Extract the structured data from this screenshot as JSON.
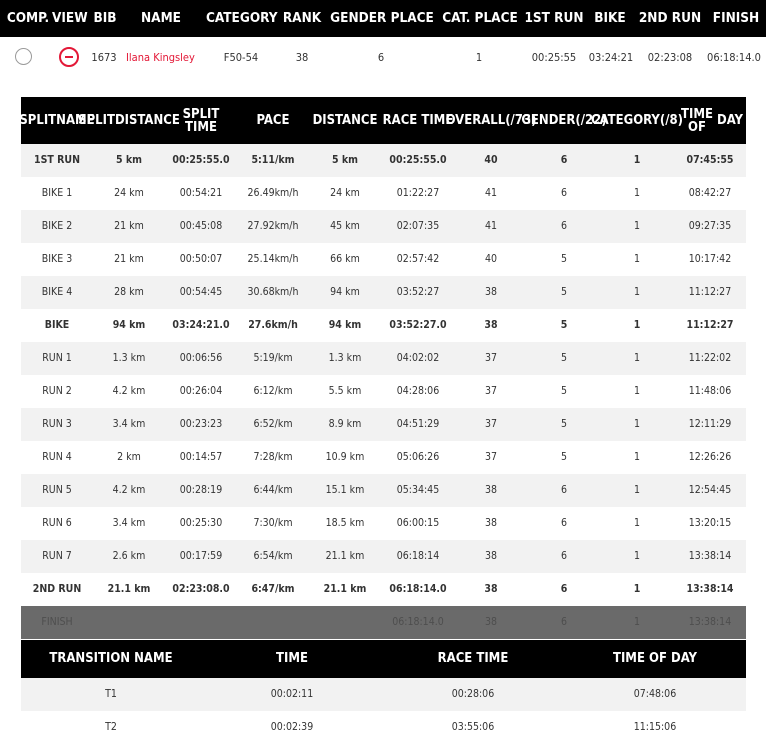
{
  "results_header": {
    "comp": "COMP.",
    "view": "VIEW",
    "bib": "BIB",
    "name": "NAME",
    "category": "CATEGORY",
    "rank": "RANK",
    "gender_place": "GENDER PLACE",
    "cat_place": "CAT. PLACE",
    "first_run": "1ST RUN",
    "bike": "BIKE",
    "second_run": "2ND RUN",
    "finish": "FINISH"
  },
  "athlete": {
    "bib": "1673",
    "name": "Ilana Kingsley",
    "category": "F50-54",
    "rank": "38",
    "gender_place": "6",
    "cat_place": "1",
    "first_run": "00:25:55",
    "bike": "03:24:21",
    "second_run": "02:23:08",
    "finish": "06:18:14.0",
    "compare_selected": false,
    "expanded": true
  },
  "splits_header": {
    "split_name": [
      "SPLIT",
      "NAME"
    ],
    "split_distance": [
      "SPLIT",
      "DISTANCE"
    ],
    "split_time": "SPLIT TIME",
    "pace": "PACE",
    "distance": "DISTANCE",
    "race_time": "RACE TIME",
    "overall": [
      "OVERALL",
      "(/73)"
    ],
    "gender": [
      "GENDER",
      "(/22)"
    ],
    "category": [
      "CATEGORY",
      "(/8)"
    ],
    "time_of_day": [
      "TIME OF",
      "DAY"
    ]
  },
  "splits": [
    {
      "name": "1ST RUN",
      "split_distance": "5 km",
      "split_time": "00:25:55.0",
      "pace": "5:11/km",
      "distance": "5 km",
      "race_time": "00:25:55.0",
      "overall": "40",
      "gender": "6",
      "category": "1",
      "time_of_day": "07:45:55",
      "summary": true
    },
    {
      "name": "BIKE 1",
      "split_distance": "24 km",
      "split_time": "00:54:21",
      "pace": "26.49km/h",
      "distance": "24 km",
      "race_time": "01:22:27",
      "overall": "41",
      "gender": "6",
      "category": "1",
      "time_of_day": "08:42:27",
      "summary": false
    },
    {
      "name": "BIKE 2",
      "split_distance": "21 km",
      "split_time": "00:45:08",
      "pace": "27.92km/h",
      "distance": "45 km",
      "race_time": "02:07:35",
      "overall": "41",
      "gender": "6",
      "category": "1",
      "time_of_day": "09:27:35",
      "summary": false
    },
    {
      "name": "BIKE 3",
      "split_distance": "21 km",
      "split_time": "00:50:07",
      "pace": "25.14km/h",
      "distance": "66 km",
      "race_time": "02:57:42",
      "overall": "40",
      "gender": "5",
      "category": "1",
      "time_of_day": "10:17:42",
      "summary": false
    },
    {
      "name": "BIKE 4",
      "split_distance": "28 km",
      "split_time": "00:54:45",
      "pace": "30.68km/h",
      "distance": "94 km",
      "race_time": "03:52:27",
      "overall": "38",
      "gender": "5",
      "category": "1",
      "time_of_day": "11:12:27",
      "summary": false
    },
    {
      "name": "BIKE",
      "split_distance": "94 km",
      "split_time": "03:24:21.0",
      "pace": "27.6km/h",
      "distance": "94 km",
      "race_time": "03:52:27.0",
      "overall": "38",
      "gender": "5",
      "category": "1",
      "time_of_day": "11:12:27",
      "summary": true
    },
    {
      "name": "RUN 1",
      "split_distance": "1.3 km",
      "split_time": "00:06:56",
      "pace": "5:19/km",
      "distance": "1.3 km",
      "race_time": "04:02:02",
      "overall": "37",
      "gender": "5",
      "category": "1",
      "time_of_day": "11:22:02",
      "summary": false
    },
    {
      "name": "RUN 2",
      "split_distance": "4.2 km",
      "split_time": "00:26:04",
      "pace": "6:12/km",
      "distance": "5.5 km",
      "race_time": "04:28:06",
      "overall": "37",
      "gender": "5",
      "category": "1",
      "time_of_day": "11:48:06",
      "summary": false
    },
    {
      "name": "RUN 3",
      "split_distance": "3.4 km",
      "split_time": "00:23:23",
      "pace": "6:52/km",
      "distance": "8.9 km",
      "race_time": "04:51:29",
      "overall": "37",
      "gender": "5",
      "category": "1",
      "time_of_day": "12:11:29",
      "summary": false
    },
    {
      "name": "RUN 4",
      "split_distance": "2 km",
      "split_time": "00:14:57",
      "pace": "7:28/km",
      "distance": "10.9 km",
      "race_time": "05:06:26",
      "overall": "37",
      "gender": "5",
      "category": "1",
      "time_of_day": "12:26:26",
      "summary": false
    },
    {
      "name": "RUN 5",
      "split_distance": "4.2 km",
      "split_time": "00:28:19",
      "pace": "6:44/km",
      "distance": "15.1 km",
      "race_time": "05:34:45",
      "overall": "38",
      "gender": "6",
      "category": "1",
      "time_of_day": "12:54:45",
      "summary": false
    },
    {
      "name": "RUN 6",
      "split_distance": "3.4 km",
      "split_time": "00:25:30",
      "pace": "7:30/km",
      "distance": "18.5 km",
      "race_time": "06:00:15",
      "overall": "38",
      "gender": "6",
      "category": "1",
      "time_of_day": "13:20:15",
      "summary": false
    },
    {
      "name": "RUN 7",
      "split_distance": "2.6 km",
      "split_time": "00:17:59",
      "pace": "6:54/km",
      "distance": "21.1 km",
      "race_time": "06:18:14",
      "overall": "38",
      "gender": "6",
      "category": "1",
      "time_of_day": "13:38:14",
      "summary": false
    },
    {
      "name": "2ND RUN",
      "split_distance": "21.1 km",
      "split_time": "02:23:08.0",
      "pace": "6:47/km",
      "distance": "21.1 km",
      "race_time": "06:18:14.0",
      "overall": "38",
      "gender": "6",
      "category": "1",
      "time_of_day": "13:38:14",
      "summary": true
    },
    {
      "name": "FINISH",
      "split_distance": "",
      "split_time": "",
      "pace": "",
      "distance": "",
      "race_time": "06:18:14.0",
      "overall": "38",
      "gender": "6",
      "category": "1",
      "time_of_day": "13:38:14",
      "summary": false,
      "finish": true
    }
  ],
  "transitions_header": {
    "name": "TRANSITION NAME",
    "time": "TIME",
    "race_time": "RACE TIME",
    "time_of_day": "TIME OF DAY"
  },
  "transitions": [
    {
      "name": "T1",
      "time": "00:02:11",
      "race_time": "00:28:06",
      "time_of_day": "07:48:06"
    },
    {
      "name": "T2",
      "time": "00:02:39",
      "race_time": "03:55:06",
      "time_of_day": "11:15:06"
    }
  ],
  "colors": {
    "header_bg": "#000000",
    "accent": "#e31837",
    "row_alt": "#f2f2f2",
    "finish_row": "#6a6a6a"
  }
}
